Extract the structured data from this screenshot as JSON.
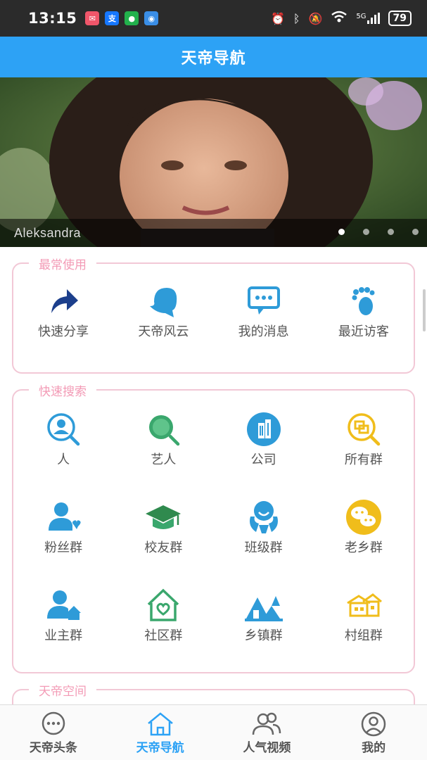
{
  "status_bar": {
    "time": "13:15",
    "network": "5G",
    "battery": "79"
  },
  "header": {
    "title": "天帝导航"
  },
  "banner": {
    "caption": "Aleksandra",
    "slide_index": 1,
    "slide_count": 4
  },
  "sections": {
    "common": {
      "title": "最常使用",
      "items": [
        {
          "label": "快速分享",
          "icon": "share-arrow-icon"
        },
        {
          "label": "天帝风云",
          "icon": "profile-head-icon"
        },
        {
          "label": "我的消息",
          "icon": "message-bubble-icon"
        },
        {
          "label": "最近访客",
          "icon": "footprint-icon"
        }
      ]
    },
    "search": {
      "title": "快速搜索",
      "items": [
        {
          "label": "人",
          "icon": "person-search-icon"
        },
        {
          "label": "艺人",
          "icon": "artist-search-icon"
        },
        {
          "label": "公司",
          "icon": "company-building-icon"
        },
        {
          "label": "所有群",
          "icon": "all-groups-search-icon"
        },
        {
          "label": "粉丝群",
          "icon": "fan-group-icon"
        },
        {
          "label": "校友群",
          "icon": "graduation-cap-icon"
        },
        {
          "label": "班级群",
          "icon": "class-group-icon"
        },
        {
          "label": "老乡群",
          "icon": "chat-faces-icon"
        },
        {
          "label": "业主群",
          "icon": "owner-home-icon"
        },
        {
          "label": "社区群",
          "icon": "community-house-icon"
        },
        {
          "label": "乡镇群",
          "icon": "town-icon"
        },
        {
          "label": "村组群",
          "icon": "village-icon"
        }
      ]
    },
    "space": {
      "title": "天帝空间"
    }
  },
  "bottom_nav": [
    {
      "label": "天帝头条",
      "icon": "chat-dots-icon",
      "active": false
    },
    {
      "label": "天帝导航",
      "icon": "home-icon",
      "active": true
    },
    {
      "label": "人气视频",
      "icon": "users-icon",
      "active": false
    },
    {
      "label": "我的",
      "icon": "user-circle-icon",
      "active": false
    }
  ],
  "colors": {
    "accent": "#2da2f5",
    "section_border": "#f2c8d6",
    "section_title": "#f39bb6",
    "icon_blue": "#2e9bd8",
    "icon_green": "#3aa76d",
    "icon_yellow": "#f0bd1b",
    "icon_navy": "#1c3f8c"
  }
}
